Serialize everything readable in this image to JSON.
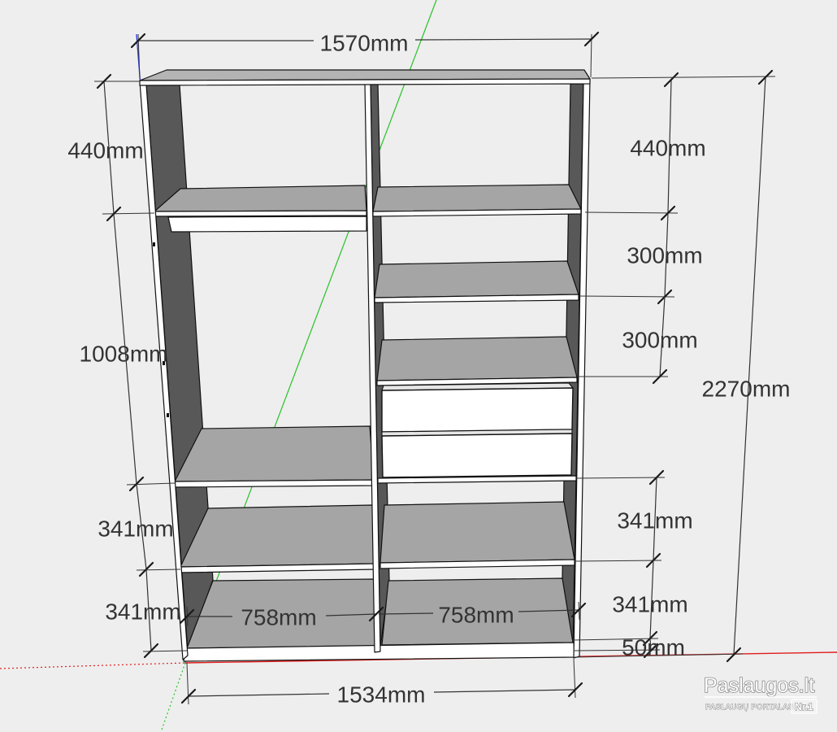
{
  "dimensions": {
    "overall_width_top": "1570mm",
    "left_top_section": "440mm",
    "left_middle_section": "1008mm",
    "left_shelf_upper": "341mm",
    "left_shelf_lower": "341mm",
    "left_bottom_width": "758mm",
    "right_bottom_width": "758mm",
    "overall_width_bottom": "1534mm",
    "right_top_section": "440mm",
    "right_shelf_1": "300mm",
    "right_shelf_2": "300mm",
    "right_shelf_upper": "341mm",
    "right_shelf_lower": "341mm",
    "plinth": "50mm",
    "overall_height": "2270mm"
  },
  "watermark": {
    "brand": "Paslaugos.lt",
    "tagline": "PASLAUGŲ PORTALAS",
    "badge": "Nr.1"
  },
  "colors": {
    "background": "#eeeeee",
    "shelf": "#a5a5a5",
    "top_face": "#b4b4b4",
    "panel_inner": "#585858",
    "edge": "#ffffff",
    "axis_red": "#e01c1c",
    "axis_green": "#27c227",
    "axis_blue": "#2433d6",
    "dimension": "#333333",
    "label": "#333333"
  }
}
